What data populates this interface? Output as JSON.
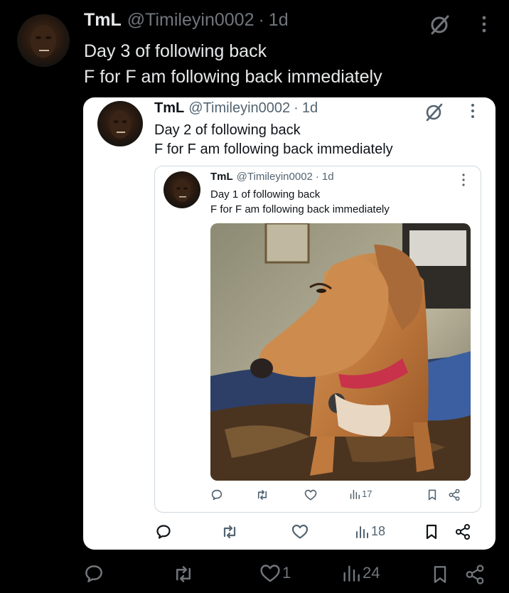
{
  "outer": {
    "name": "TmL",
    "handle": "@Timileyin0002",
    "sep": "·",
    "time": "1d",
    "line1": "Day 3 of following back",
    "line2": "F for F am following back immediately",
    "likes": "1",
    "views": "24"
  },
  "mid": {
    "name": "TmL",
    "handle": "@Timileyin0002",
    "sep": "·",
    "time": "1d",
    "line1": "Day 2 of following back",
    "line2": "F for F am following back immediately",
    "views": "18"
  },
  "inner": {
    "name": "TmL",
    "handle": "@Timileyin0002",
    "sep": "·",
    "time": "1d",
    "line1": "Day 1 of following back",
    "line2": "F for F am following back immediately",
    "views": "17"
  },
  "colors": {
    "background": "#000000",
    "card": "#ffffff",
    "dark_text": "#e7e9ea",
    "muted_dark": "#71767b",
    "light_text": "#0f1419",
    "muted_light": "#536471",
    "icon_light": "#536471",
    "card_border": "#cfd9de"
  },
  "icons": [
    "grok-icon",
    "more-icon",
    "reply-icon",
    "repost-icon",
    "like-icon",
    "views-icon",
    "bookmark-icon",
    "share-icon"
  ]
}
